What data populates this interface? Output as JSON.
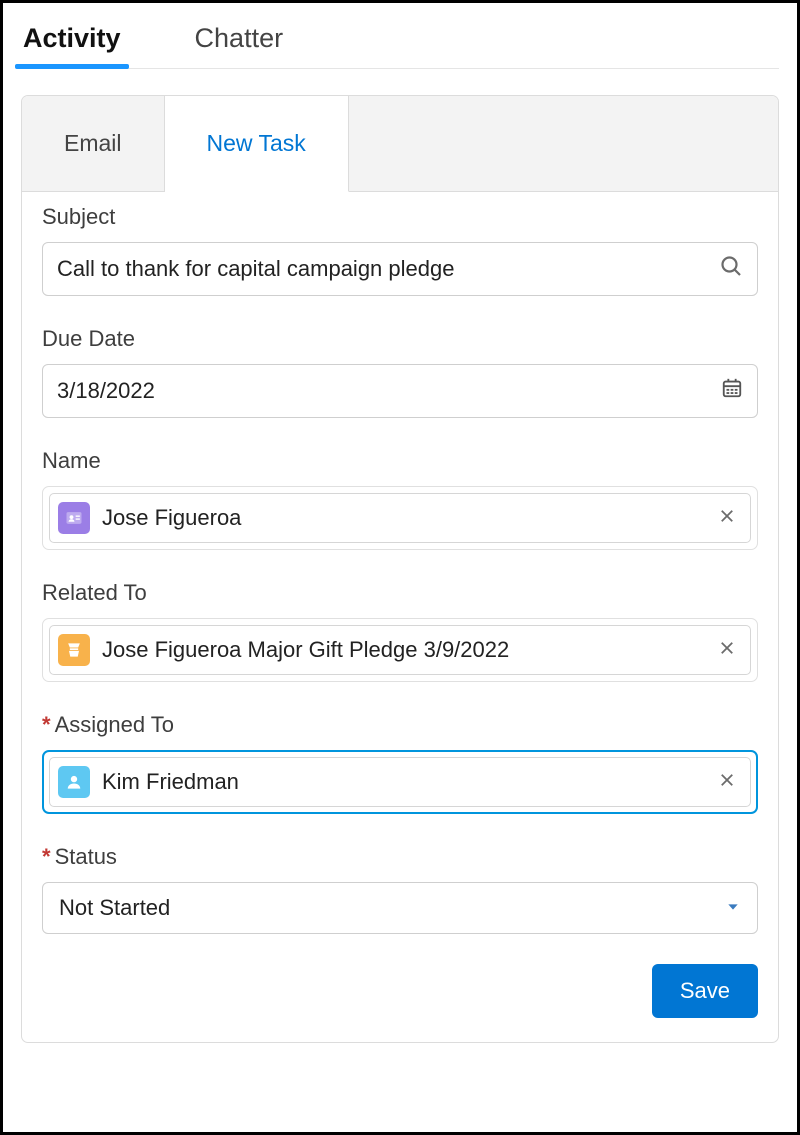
{
  "primaryTabs": {
    "activity": "Activity",
    "chatter": "Chatter"
  },
  "subTabs": {
    "email": "Email",
    "newTask": "New Task"
  },
  "form": {
    "subject": {
      "label": "Subject",
      "value": "Call to thank for capital campaign pledge"
    },
    "dueDate": {
      "label": "Due Date",
      "value": "3/18/2022"
    },
    "name": {
      "label": "Name",
      "value": "Jose Figueroa"
    },
    "relatedTo": {
      "label": "Related To",
      "value": "Jose Figueroa Major Gift Pledge 3/9/2022"
    },
    "assignedTo": {
      "label": "Assigned To",
      "value": "Kim Friedman"
    },
    "status": {
      "label": "Status",
      "value": "Not Started"
    }
  },
  "actions": {
    "save": "Save"
  }
}
